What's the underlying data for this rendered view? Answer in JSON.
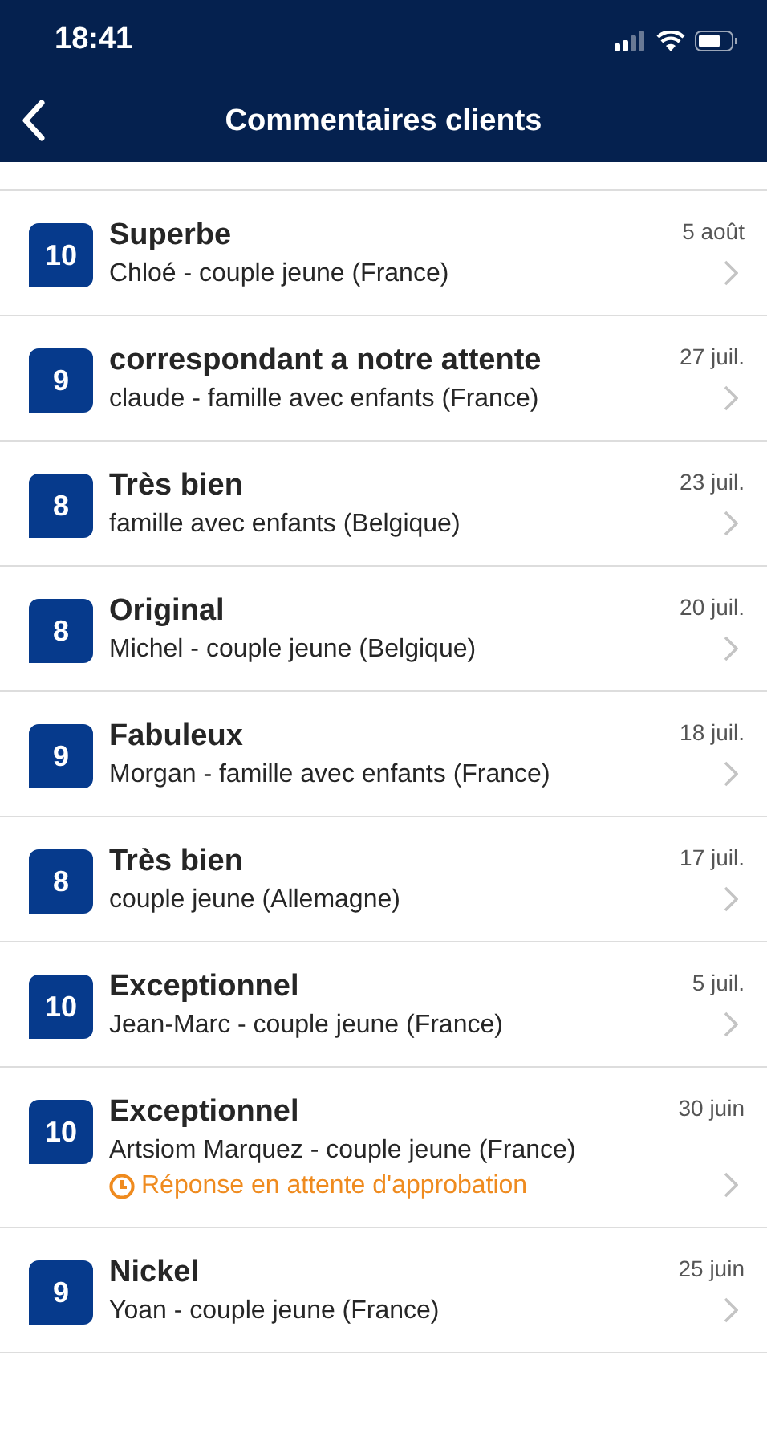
{
  "status_bar": {
    "time": "18:41"
  },
  "nav": {
    "title": "Commentaires clients"
  },
  "reviews": [
    {
      "score": "10",
      "title": "Superbe",
      "subtitle": "Chloé - couple jeune (France)",
      "date": "5 août"
    },
    {
      "score": "9",
      "title": "correspondant a notre attente",
      "subtitle": "claude - famille avec enfants (France)",
      "date": "27 juil."
    },
    {
      "score": "8",
      "title": "Très bien",
      "subtitle": "famille avec enfants (Belgique)",
      "date": "23 juil."
    },
    {
      "score": "8",
      "title": "Original",
      "subtitle": "Michel - couple jeune (Belgique)",
      "date": "20 juil."
    },
    {
      "score": "9",
      "title": "Fabuleux",
      "subtitle": "Morgan - famille avec enfants (France)",
      "date": "18 juil."
    },
    {
      "score": "8",
      "title": "Très bien",
      "subtitle": "couple jeune (Allemagne)",
      "date": "17 juil."
    },
    {
      "score": "10",
      "title": "Exceptionnel",
      "subtitle": "Jean-Marc - couple jeune (France)",
      "date": "5 juil."
    },
    {
      "score": "10",
      "title": "Exceptionnel",
      "subtitle": "Artsiom Marquez - couple jeune (France)",
      "date": "30 juin",
      "status": "Réponse en attente d'approbation"
    },
    {
      "score": "9",
      "title": "Nickel",
      "subtitle": "Yoan - couple jeune (France)",
      "date": "25 juin"
    }
  ]
}
